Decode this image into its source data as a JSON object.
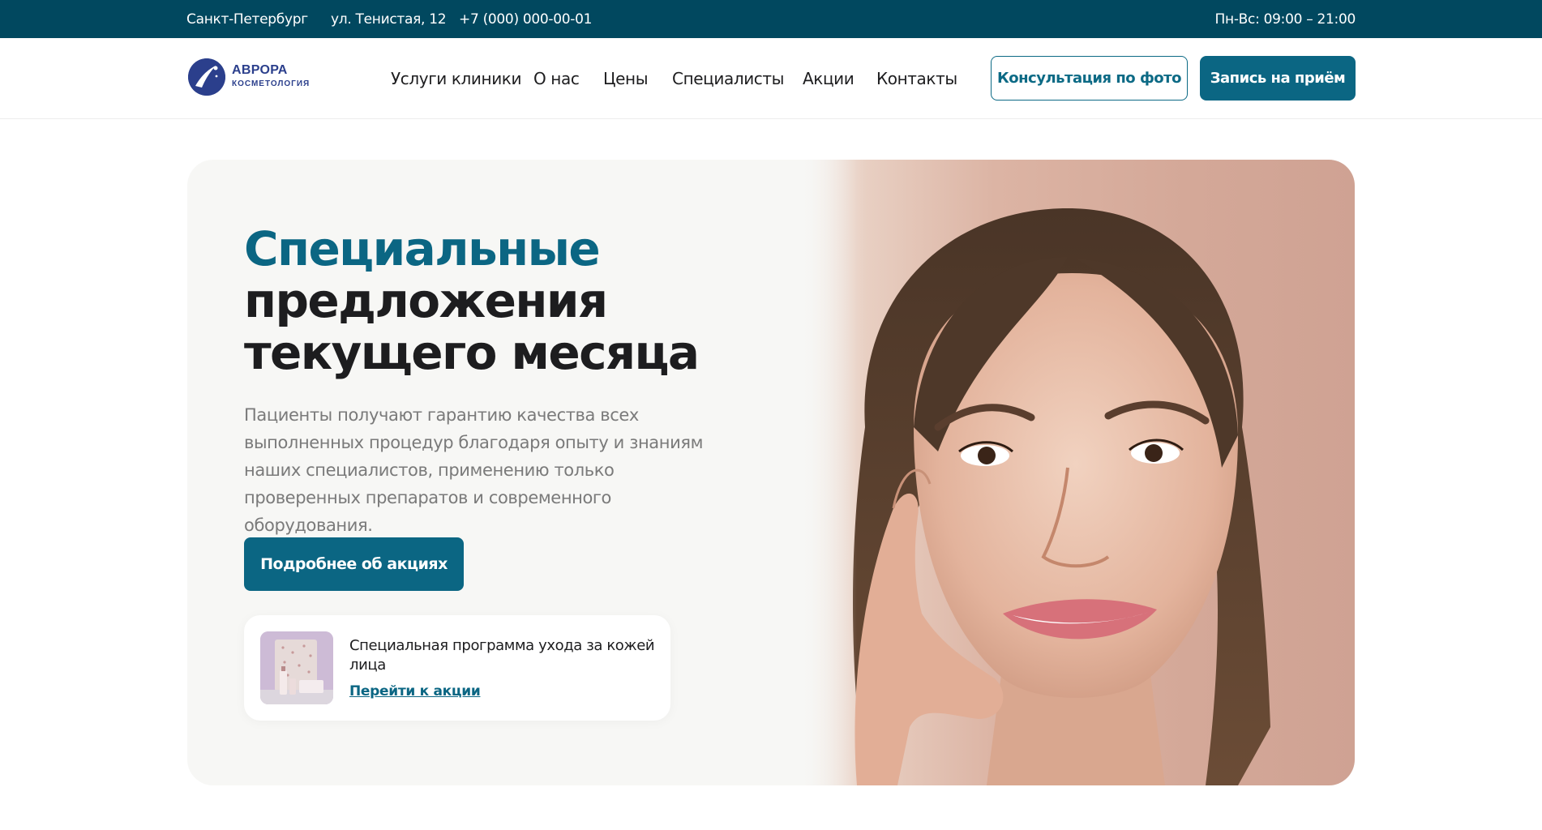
{
  "topbar": {
    "city": "Санкт-Петербург",
    "address": "ул. Тенистая, 12",
    "phone": "+7 (000) 000-00-01",
    "hours": "Пн-Вс: 09:00 – 21:00"
  },
  "logo": {
    "name": "АВРОРА",
    "subtitle": "КОСМЕТОЛОГИЯ"
  },
  "nav": {
    "items": [
      {
        "label": "Услуги клиники"
      },
      {
        "label": "О нас"
      },
      {
        "label": "Цены"
      },
      {
        "label": "Специалисты"
      },
      {
        "label": "Акции"
      },
      {
        "label": "Контакты"
      }
    ]
  },
  "header_buttons": {
    "photo_consultation": "Консультация по фото",
    "appointment": "Запись на приём"
  },
  "hero": {
    "title_accent": "Специальные",
    "title_line2": "предложения",
    "title_line3": "текущего месяца",
    "description": "Пациенты получают гарантию качества всех выполненных процедур благодаря опыту и знаниям наших специалистов, применению только проверенных препаратов и современного оборудования.",
    "cta_label": "Подробнее об акциях",
    "promo_card": {
      "title": "Специальная программа ухода за кожей лица",
      "link": "Перейти к акции"
    }
  },
  "colors": {
    "topbar_bg": "#01485f",
    "accent": "#0b6683",
    "logo": "#2b3f8c",
    "hero_bg": "#f7f7f5"
  }
}
